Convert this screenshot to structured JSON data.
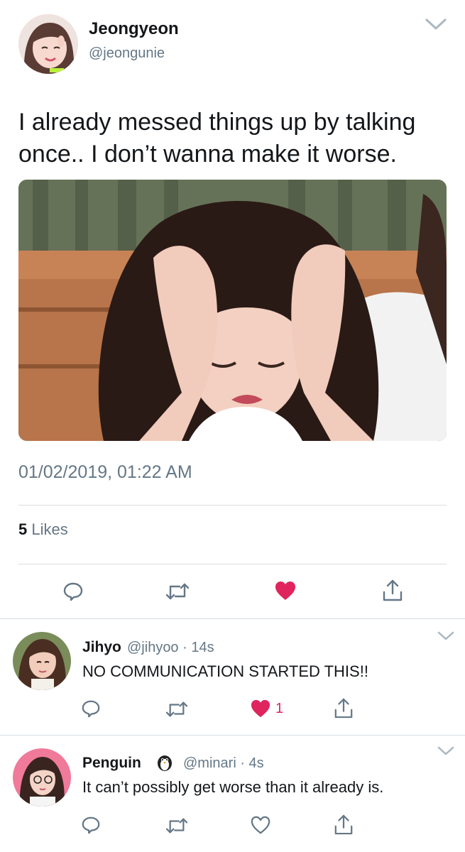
{
  "main_tweet": {
    "author": {
      "display_name": "Jeongyeon",
      "handle": "@jeongunie",
      "avatar_icon": "profile-photo"
    },
    "text_line1": "I already messed things up by talking",
    "text_line2": "once.. I don’t wanna make it worse.",
    "media": "photo-girl-holding-head",
    "timestamp": "01/02/2019, 01:22 AM",
    "likes_count": "5",
    "likes_label": "Likes",
    "liked": true,
    "actions": [
      "reply-icon",
      "retweet-icon",
      "heart-icon",
      "share-icon"
    ]
  },
  "replies": [
    {
      "display_name": "Jihyo",
      "handle": "@jihyoo",
      "time": "· 14s",
      "text": "NO COMMUNICATION STARTED THIS!!",
      "like_count": "1",
      "liked": true
    },
    {
      "display_name": "Penguin",
      "emoji_icon": "penguin-icon",
      "handle": "@minari",
      "time": "· 4s",
      "text": "It can’t possibly get worse than it already is.",
      "like_count": "",
      "liked": false
    }
  ],
  "colors": {
    "text": "#14171a",
    "secondary": "#657786",
    "divider": "#d8dde1",
    "like": "#e0245e"
  }
}
